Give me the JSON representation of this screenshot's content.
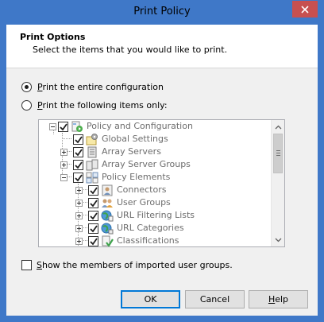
{
  "window": {
    "title": "Print Policy"
  },
  "header": {
    "title": "Print Options",
    "subtitle": "Select the items that you would like to print."
  },
  "options": {
    "entire": {
      "label_first": "P",
      "label_rest": "rint the entire configuration",
      "selected": true
    },
    "following": {
      "label_first": "P",
      "label_rest": "rint the following items only:",
      "selected": false
    }
  },
  "tree": {
    "items": [
      {
        "label": "Policy and Configuration",
        "icon": "policy-config-icon",
        "checked": true,
        "expander": "minus"
      },
      {
        "label": "Global Settings",
        "icon": "global-settings-icon",
        "checked": true,
        "expander": "none"
      },
      {
        "label": "Array Servers",
        "icon": "array-servers-icon",
        "checked": true,
        "expander": "plus"
      },
      {
        "label": "Array Server Groups",
        "icon": "array-server-groups-icon",
        "checked": true,
        "expander": "plus"
      },
      {
        "label": "Policy Elements",
        "icon": "policy-elements-icon",
        "checked": true,
        "expander": "minus"
      },
      {
        "label": "Connectors",
        "icon": "connectors-icon",
        "checked": true,
        "expander": "plus"
      },
      {
        "label": "User Groups",
        "icon": "user-groups-icon",
        "checked": true,
        "expander": "plus"
      },
      {
        "label": "URL Filtering Lists",
        "icon": "url-filtering-lists-icon",
        "checked": true,
        "expander": "plus"
      },
      {
        "label": "URL Categories",
        "icon": "url-categories-icon",
        "checked": true,
        "expander": "plus"
      },
      {
        "label": "Classifications",
        "icon": "classifications-icon",
        "checked": true,
        "expander": "plus"
      }
    ]
  },
  "show_members": {
    "label_first": "S",
    "label_rest": "how the members of imported user groups.",
    "checked": false
  },
  "buttons": {
    "ok": "OK",
    "cancel": "Cancel",
    "help_first": "H",
    "help_rest": "elp"
  }
}
